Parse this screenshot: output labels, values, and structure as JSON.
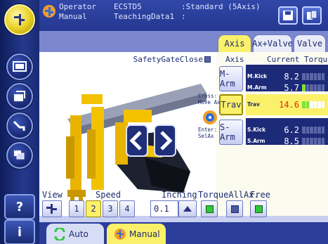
{
  "header": {
    "operator": "Operator",
    "mode": "Manual",
    "controller": "ECSTD5",
    "data": "TeachingData1",
    "standard_label": ":Standard (5Axis)",
    "colon": ":"
  },
  "panel": {
    "safety_label": "SafetyGateClose",
    "tabs": [
      {
        "label": "Axis",
        "active": true
      },
      {
        "label": "Ax+Valve",
        "active": false
      },
      {
        "label": "Valve",
        "active": false
      }
    ],
    "axis_header": "Axis",
    "torque_header": "Current Torque",
    "cross_label": "Cross:",
    "move_label": "Move Ax",
    "enter_label": "Enter:",
    "sel_label": "SelAx",
    "axis_buttons": [
      {
        "label": "M-Arm"
      },
      {
        "label": "Trav"
      },
      {
        "label": "S-Arm"
      }
    ],
    "torque": [
      {
        "name": "M.Kick",
        "value": "8.2",
        "segments_on": 0
      },
      {
        "name": "M.Arm",
        "value": "5.7",
        "segments_on": 1
      },
      {
        "name": "Trav",
        "value": "14.6",
        "segments_on": 2
      },
      {
        "name": "S.Kick",
        "value": "6.2",
        "segments_on": 0
      },
      {
        "name": "S.Arm",
        "value": "8.5",
        "segments_on": 0
      }
    ]
  },
  "controls": {
    "view_label": "View",
    "speed_label": "Speed",
    "inching_label": "Inching",
    "torque_all_label": "TorqueAllAx.",
    "free_label": "Free",
    "speeds": [
      "1",
      "2",
      "3",
      "4"
    ],
    "selected_speed": "2",
    "inching_value": "0.1"
  },
  "bottom_tabs": {
    "auto": "Auto",
    "manual": "Manual"
  },
  "rail": {
    "help": "?",
    "info": "i"
  },
  "colors": {
    "accent": "#fbf06a",
    "panel": "#c9cff0",
    "navy": "#1d2a78",
    "led_green": "#7ce43a"
  }
}
